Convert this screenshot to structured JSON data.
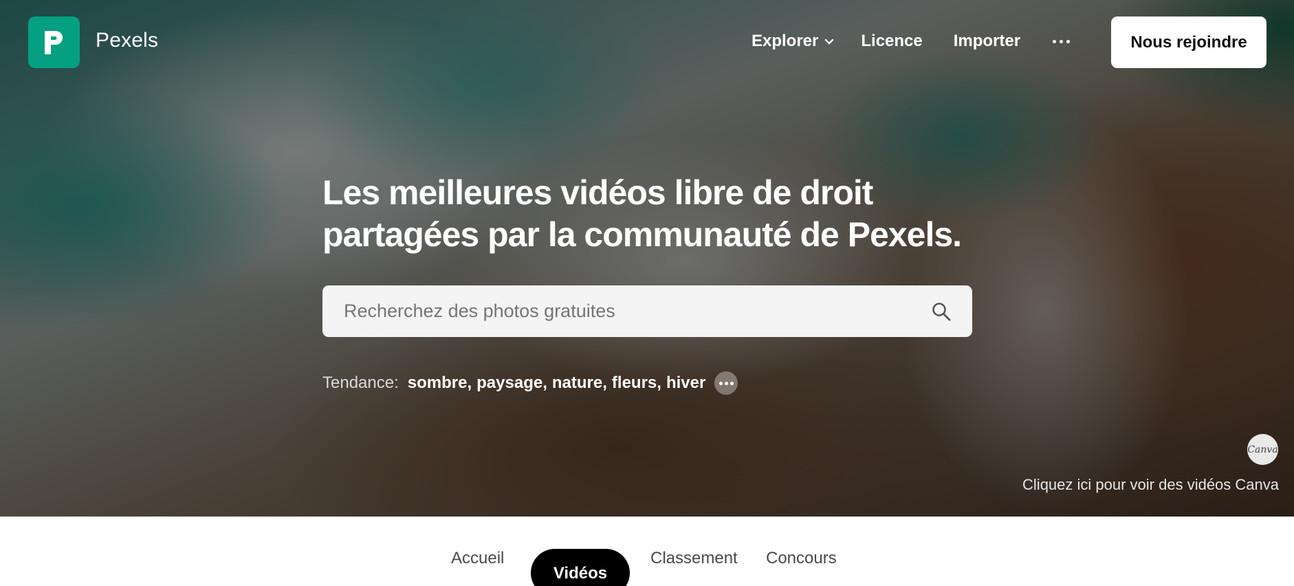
{
  "nav": {
    "brand": "Pexels",
    "explore": "Explorer",
    "licence": "Licence",
    "import": "Importer",
    "join": "Nous rejoindre"
  },
  "hero": {
    "headline_line1": "Les meilleures vidéos libre de droit",
    "headline_line2": "partagées par la communauté de Pexels.",
    "search_placeholder": "Recherchez des photos gratuites",
    "trending_label": "Tendance:",
    "trending": [
      "sombre",
      "paysage",
      "nature",
      "fleurs",
      "hiver"
    ],
    "canva_badge": "Canva",
    "canva_link": "Cliquez ici pour voir des vidéos Canva"
  },
  "tabs": [
    "Accueil",
    "Vidéos",
    "Classement",
    "Concours"
  ],
  "colors": {
    "brand": "#05a081",
    "active_tab": "#000000"
  }
}
